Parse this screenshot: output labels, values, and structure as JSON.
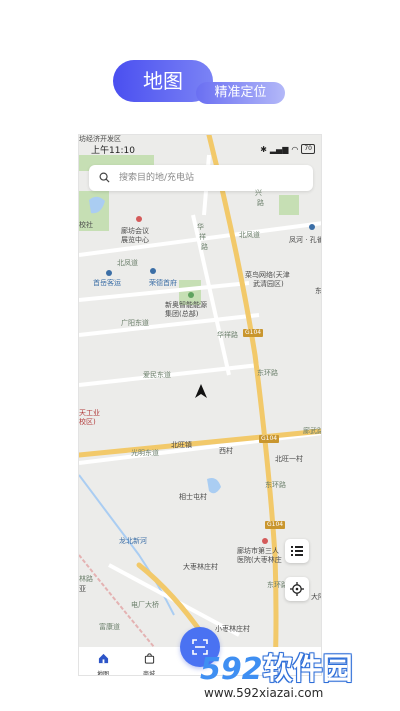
{
  "header": {
    "title": "地图",
    "subtitle": "精准定位"
  },
  "status": {
    "time": "上午11:10",
    "battery": "70"
  },
  "search": {
    "placeholder": "搜索目的地/充电站"
  },
  "map": {
    "labels": {
      "top_cut": "坊经济开发区",
      "xing": "兴",
      "lu_top": "路",
      "school_left": "校社",
      "conf_center_1": "廊坊会议",
      "conf_center_2": "展览中心",
      "huaxiang_1": "华",
      "huaxiang_2": "祥",
      "huaxiang_3": "路",
      "beifeng_right": "北凤道",
      "fenghe": "凤河 · 孔雀",
      "beifeng_left": "北凤道",
      "guangyang_station": "首岳客运",
      "rongde": "荣德首府",
      "cainiao_1": "菜鸟网络(天津",
      "cainiao_2": "武清园区)",
      "dong_edge": "东",
      "xinao_1": "新奥智能能源",
      "xinao_2": "集团(总部)",
      "guangyang_east": "广阳东道",
      "huaxiang_low": "华祥路",
      "aimin_east": "爱民东道",
      "donghuan_1": "东环路",
      "tianjin_1": "天工业",
      "tianjin_2": "校区)",
      "langwu": "廊武路",
      "guangming_east": "光明东道",
      "beiwangzhen": "北旺镇",
      "xicun": "西村",
      "beiwang_yicun": "北旺一村",
      "donghuan_2": "东环路",
      "xiangshi": "相士屯村",
      "longbei": "龙北新河",
      "hospital_1": "廊坊市第三人",
      "hospital_2": "医院(大枣林庄",
      "dazaolin": "大枣林庄村",
      "donghuan_3": "东环路",
      "da": "大阿",
      "changtong": "电厂大桥",
      "fuyuan": "富康道",
      "xiaozaolin": "小枣林庄村",
      "lin": "林路",
      "ya": "亚"
    },
    "shields": [
      "G104",
      "G104",
      "G104"
    ],
    "poi_icons": [
      "pin-icon",
      "bus-icon",
      "building-icon",
      "tree-icon"
    ]
  },
  "tabs": [
    {
      "label": "地图",
      "icon": "home-icon",
      "active": true
    },
    {
      "label": "商城",
      "icon": "bag-icon",
      "active": false
    }
  ],
  "colors": {
    "accent": "#4a4ff0",
    "fab": "#4a72f2",
    "road_major": "#f2c96a",
    "road_minor": "#ffffff",
    "green": "#c6dfb4",
    "water": "#aacdf2"
  },
  "watermark": {
    "logo_num": "592",
    "logo_text": "软件园",
    "url": "www.592xiazai.com"
  }
}
